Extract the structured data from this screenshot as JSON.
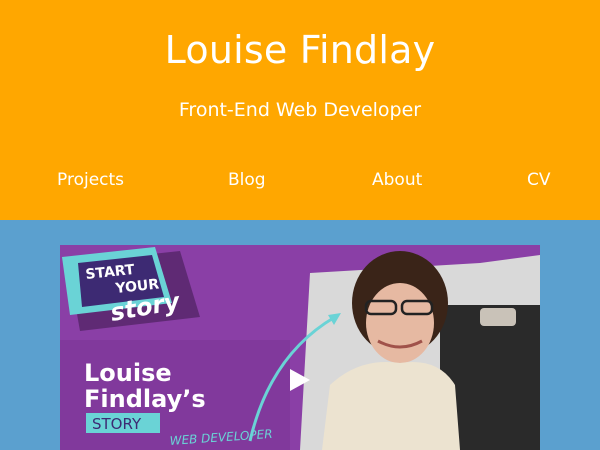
{
  "header": {
    "title": "Louise Findlay",
    "subtitle": "Front-End Web Developer"
  },
  "nav": {
    "items": [
      {
        "label": "Projects"
      },
      {
        "label": "Blog"
      },
      {
        "label": "About"
      },
      {
        "label": "CV"
      }
    ]
  },
  "video": {
    "badge_line1": "START",
    "badge_line2": "YOUR",
    "badge_line3": "story",
    "name_line1": "Louise",
    "name_line2": "Findlay’s",
    "story_label": "STORY",
    "role_label": "WEB DEVELOPER"
  },
  "colors": {
    "header_bg": "#ffa700",
    "page_bg": "#5ba0cf",
    "video_purple": "#8a3fa6",
    "accent_teal": "#6ad3d6"
  },
  "icons": {
    "play": "play-icon"
  }
}
